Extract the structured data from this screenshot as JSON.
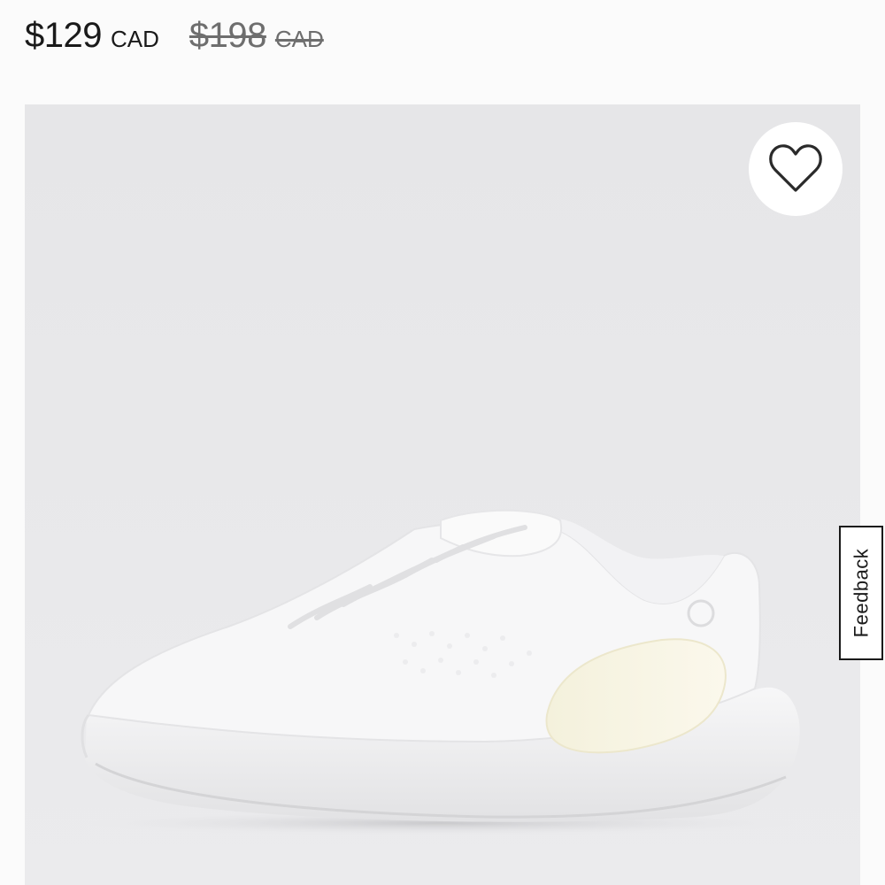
{
  "product": {
    "price": {
      "current_amount": "$129",
      "current_currency": "CAD",
      "original_amount": "$198",
      "original_currency": "CAD"
    },
    "image": {
      "subject": "white running shoe",
      "background_color": "#e8e8ea"
    },
    "wishlist": {
      "icon": "heart-outline-icon"
    }
  },
  "feedback": {
    "label": "Feedback"
  },
  "colors": {
    "text": "#1a1a1a",
    "strikethrough_text": "#6e6e6e"
  }
}
